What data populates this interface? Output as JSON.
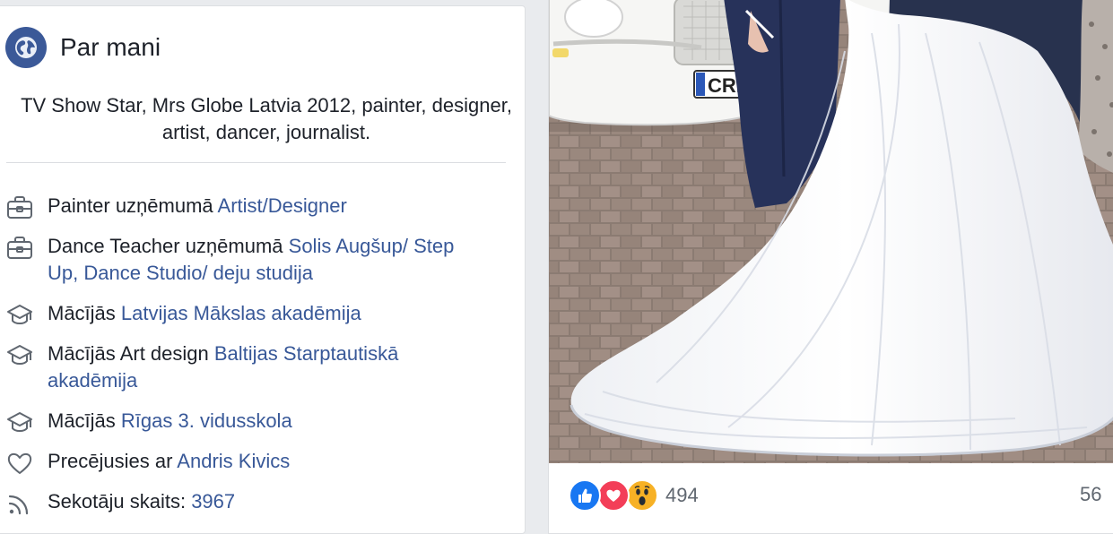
{
  "about": {
    "title": "Par mani",
    "bio": "TV Show Star, Mrs Globe Latvia 2012, painter, designer, artist, dancer, journalist.",
    "items": [
      {
        "icon": "briefcase-icon",
        "prefix": "Painter uzņēmumā ",
        "link": "Artist/Designer"
      },
      {
        "icon": "briefcase-icon",
        "prefix": "Dance Teacher uzņēmumā ",
        "link": "Solis Augšup/ Step Up, Dance Studio/ deju studija"
      },
      {
        "icon": "graduation-cap-icon",
        "prefix": "Mācījās ",
        "link": "Latvijas Mākslas akadēmija"
      },
      {
        "icon": "graduation-cap-icon",
        "prefix": "Mācījās Art design ",
        "link": "Baltijas Starptautiskā akadēmija"
      },
      {
        "icon": "graduation-cap-icon",
        "prefix": "Mācījās ",
        "link": "Rīgas 3. vidusskola"
      },
      {
        "icon": "heart-outline-icon",
        "prefix": "Precējusies ar ",
        "link": "Andris Kivics"
      },
      {
        "icon": "rss-feed-icon",
        "prefix": "Sekotāju skaits: ",
        "link": "3967"
      }
    ]
  },
  "post": {
    "plate_text": "CRK",
    "reactions": [
      "like-reaction-icon",
      "love-reaction-icon",
      "wow-reaction-icon"
    ],
    "reaction_count": "494",
    "comments_count": "56"
  },
  "colors": {
    "link": "#385898",
    "brand": "#3b5998",
    "like": "#1877f2",
    "love": "#f33e58",
    "wow": "#f7b125"
  }
}
